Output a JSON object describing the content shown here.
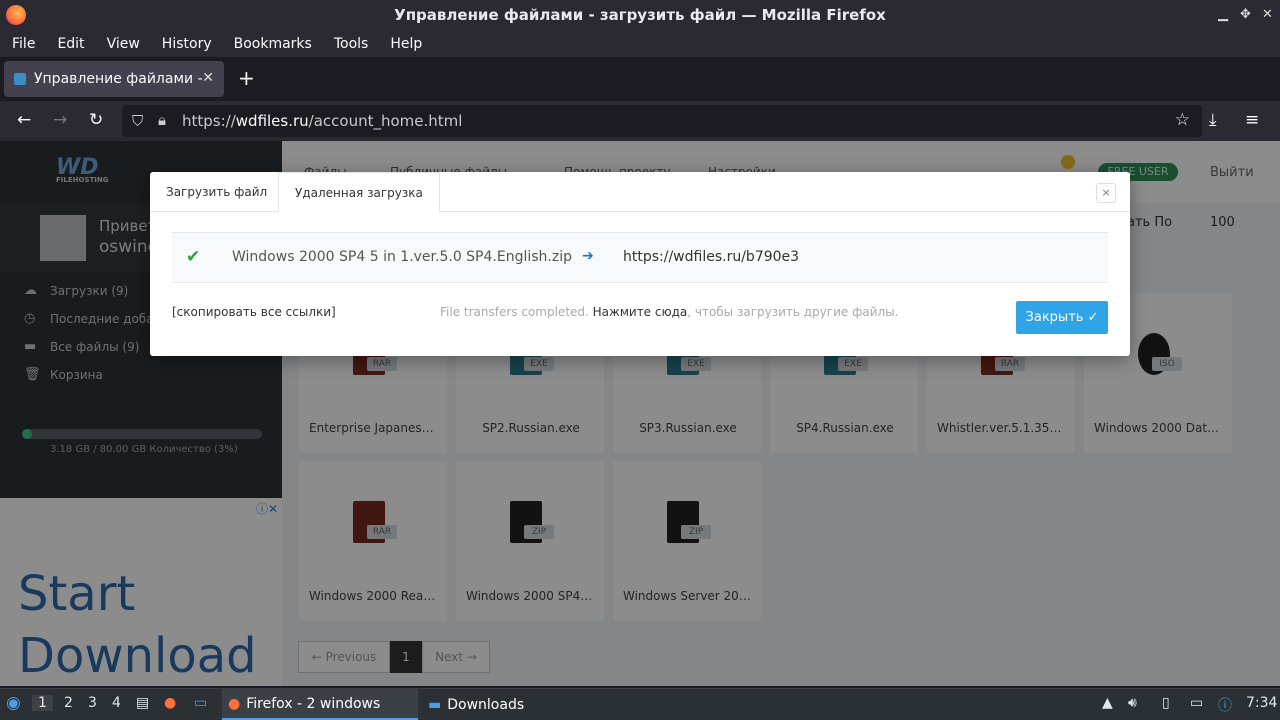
{
  "window": {
    "title": "Управление файлами - загрузить файл — Mozilla Firefox"
  },
  "menu": [
    "File",
    "Edit",
    "View",
    "History",
    "Bookmarks",
    "Tools",
    "Help"
  ],
  "tab": {
    "title": "Управление файлами -"
  },
  "url": {
    "prefix": "https://",
    "domain": "wdfiles.ru",
    "path": "/account_home.html"
  },
  "site": {
    "logo": "WD",
    "logo_sub": "FILEHOSTING",
    "greeting": "Привет",
    "username": "oswinc",
    "nav": [
      "Файлы",
      "Публичные файлы",
      "Помощь проекту",
      "Настройки"
    ],
    "free_user": "FREE USER",
    "logout": "Выйти",
    "sidebar": [
      {
        "icon": "cloud-upload-icon",
        "label": "Загрузки (9)"
      },
      {
        "icon": "clock-icon",
        "label": "Последние добав"
      },
      {
        "icon": "folder-icon",
        "label": "Все файлы (9)"
      },
      {
        "icon": "trash-icon",
        "label": "Корзина"
      }
    ],
    "storage_fraction": 0.04,
    "usage": "3.18 GB / 80.00 GB Количество (3%)",
    "sort_label": "ать По",
    "per_page": "100",
    "files": [
      {
        "name": "Enterprise Japanese.…",
        "type": "RAR"
      },
      {
        "name": "SP2.Russian.exe",
        "type": "EXE"
      },
      {
        "name": "SP3.Russian.exe",
        "type": "EXE"
      },
      {
        "name": "SP4.Russian.exe",
        "type": "EXE"
      },
      {
        "name": "Whistler.ver.5.1.3531.…",
        "type": "RAR"
      },
      {
        "name": "Windows 2000 Datac…",
        "type": "ISO"
      },
      {
        "name": "Windows 2000 Ready…",
        "type": "RAR"
      },
      {
        "name": "Windows 2000 SP4 5 …",
        "type": "ZIP"
      },
      {
        "name": "Windows Server 2003…",
        "type": "ZIP"
      }
    ],
    "pager": {
      "prev": "← Previous",
      "page": "1",
      "next": "Next →"
    },
    "ad": {
      "line1": "Start",
      "line2": "Download"
    }
  },
  "modal": {
    "tab_upload": "Загрузить файл",
    "tab_remote": "Удаленная загрузка",
    "close_x": "×",
    "file_name": "Windows 2000 SP4 5 in 1.ver.5.0 SP4.English.zip",
    "arrow": "➔",
    "file_link": "https://wdfiles.ru/b790e3",
    "copy_all": "[скопировать все ссылки]",
    "status_pre": "File transfers completed. ",
    "status_link": "Нажмите сюда",
    "status_post": ", чтобы загрузить другие файлы.",
    "close_button": "Закрыть ✓"
  },
  "taskbar": {
    "workspaces": [
      "1",
      "2",
      "3",
      "4"
    ],
    "task1": "Firefox - 2 windows",
    "task2": "Downloads",
    "clock": "7:34"
  }
}
